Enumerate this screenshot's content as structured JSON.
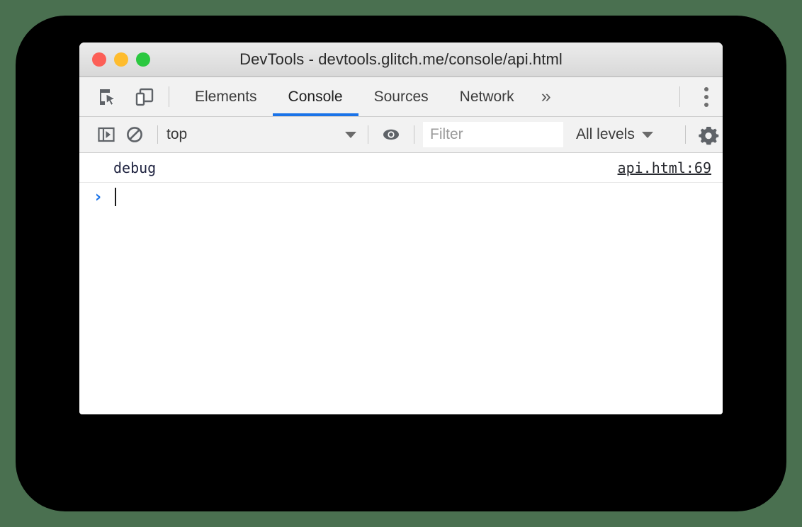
{
  "window": {
    "title": "DevTools - devtools.glitch.me/console/api.html",
    "traffic_lights": [
      {
        "name": "close",
        "color": "#fc5f57"
      },
      {
        "name": "minimize",
        "color": "#febc2e"
      },
      {
        "name": "zoom",
        "color": "#2bc840"
      }
    ]
  },
  "toolbar": {
    "inspect_icon": "inspect-element-icon",
    "device_icon": "device-toolbar-icon",
    "tabs": [
      {
        "label": "Elements",
        "active": false
      },
      {
        "label": "Console",
        "active": true
      },
      {
        "label": "Sources",
        "active": false
      },
      {
        "label": "Network",
        "active": false
      }
    ],
    "more_tabs_label": "»",
    "main_menu_icon": "kebab-menu-icon",
    "active_tab_color": "#1a73e8"
  },
  "filter_bar": {
    "sidebar_icon": "console-sidebar-icon",
    "clear_icon": "clear-console-icon",
    "context_value": "top",
    "eye_icon": "live-expression-eye-icon",
    "filter_placeholder": "Filter",
    "filter_value": "",
    "levels_label": "All levels",
    "settings_icon": "settings-gear-icon"
  },
  "console": {
    "messages": [
      {
        "text": "debug",
        "source": "api.html:69"
      }
    ],
    "prompt_symbol": "›",
    "prompt_value": ""
  }
}
